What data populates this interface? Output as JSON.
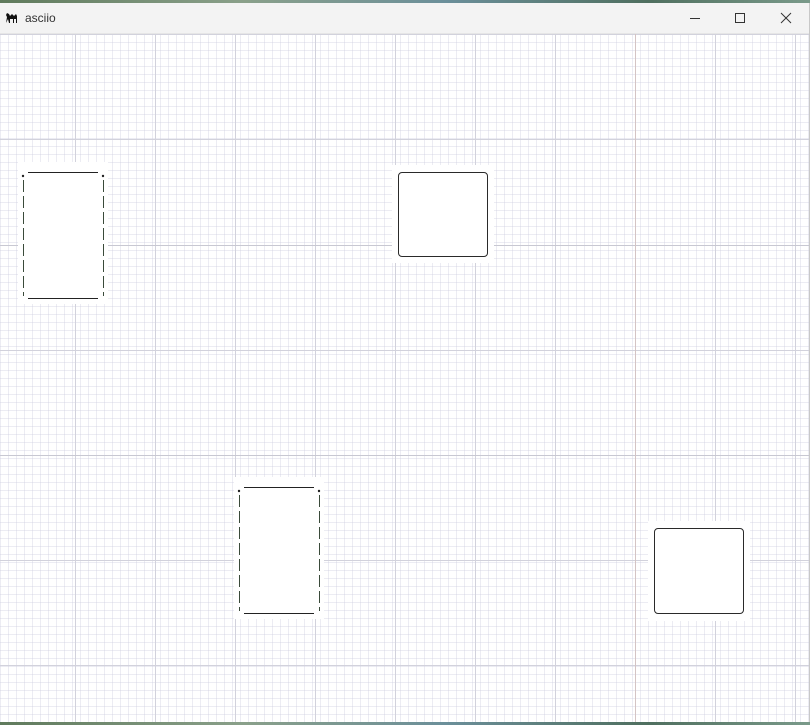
{
  "window": {
    "title": "asciio",
    "app_icon": "camel-icon",
    "controls": [
      "minimize-icon",
      "maximize-icon",
      "close-icon"
    ]
  },
  "canvas": {
    "grid_color": "#dcdce8",
    "major_grid_color": "#c8c8d4",
    "accent_line_color": "#d8c8c8"
  },
  "elements": [
    {
      "kind": "dashed-box",
      "name": "dashed-box-1"
    },
    {
      "kind": "rounded-box",
      "name": "rounded-box-1"
    },
    {
      "kind": "dashed-box",
      "name": "dashed-box-2"
    },
    {
      "kind": "rounded-box",
      "name": "rounded-box-2"
    }
  ]
}
